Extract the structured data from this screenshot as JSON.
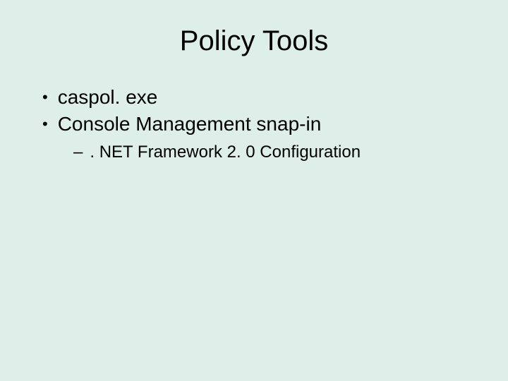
{
  "title": "Policy Tools",
  "bullets": [
    {
      "text": "caspol. exe"
    },
    {
      "text": "Console Management snap-in"
    }
  ],
  "subbullets": [
    {
      "text": ". NET Framework 2. 0 Configuration"
    }
  ]
}
